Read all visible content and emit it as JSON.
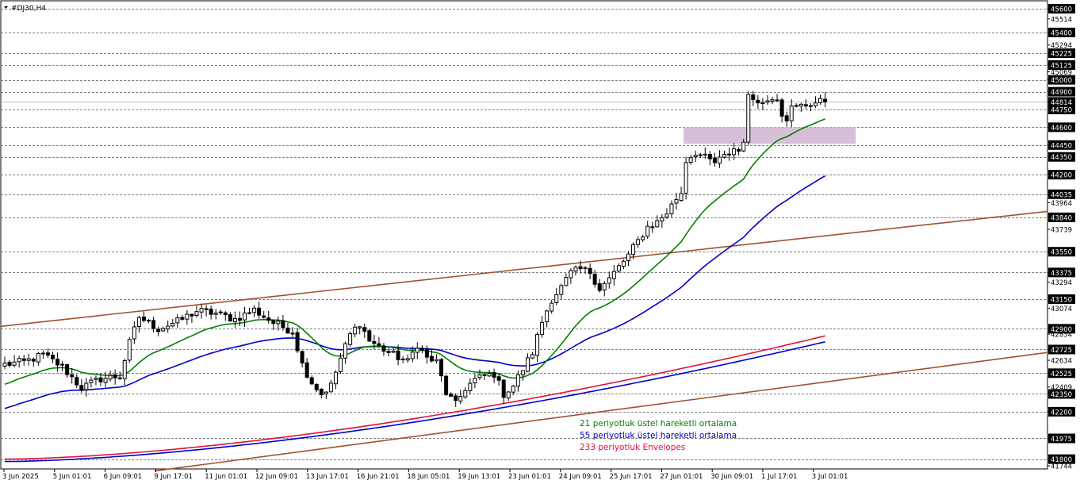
{
  "window": {
    "symbol_title": "#DJ30,H4"
  },
  "chart_data": {
    "type": "candlestick",
    "symbol": "#DJ30",
    "timeframe": "H4",
    "ylim": [
      41744,
      45600
    ],
    "current_price": 44814,
    "price_axis_labels": [
      45600,
      45514,
      45400,
      45294,
      45225,
      45125,
      45069,
      45000,
      44900,
      44814,
      44750,
      44600,
      44450,
      44350,
      44200,
      44035,
      43964,
      43840,
      43739,
      43550,
      43375,
      43294,
      43150,
      43074,
      42900,
      42854,
      42725,
      42634,
      42525,
      42409,
      42350,
      42200,
      41975,
      41800,
      41744
    ],
    "horizontal_levels": [
      45600,
      45400,
      45225,
      45125,
      45000,
      44900,
      44750,
      44600,
      44450,
      44350,
      44200,
      44035,
      43840,
      43550,
      43375,
      43150,
      42900,
      42725,
      42525,
      42350,
      42200,
      41975,
      41800
    ],
    "time_labels": [
      "3 Jun 2025",
      "5 Jun 01:01",
      "6 Jun 09:01",
      "9 Jun 17:01",
      "11 Jun 01:01",
      "12 Jun 09:01",
      "13 Jun 17:01",
      "16 Jun 21:01",
      "18 Jun 05:01",
      "19 Jun 13:01",
      "23 Jun 01:01",
      "24 Jun 09:01",
      "25 Jun 17:01",
      "27 Jun 01:01",
      "30 Jun 09:01",
      "1 Jul 17:01",
      "3 Jul 01:01"
    ],
    "candles_count": 172,
    "waypoints": [
      [
        0,
        42600
      ],
      [
        4,
        42620
      ],
      [
        8,
        42680
      ],
      [
        12,
        42580
      ],
      [
        16,
        42400
      ],
      [
        20,
        42480
      ],
      [
        24,
        42500
      ],
      [
        26,
        42780
      ],
      [
        28,
        43000
      ],
      [
        32,
        42900
      ],
      [
        36,
        42960
      ],
      [
        40,
        43050
      ],
      [
        44,
        43030
      ],
      [
        48,
        42980
      ],
      [
        52,
        43060
      ],
      [
        56,
        42950
      ],
      [
        60,
        42880
      ],
      [
        62,
        42600
      ],
      [
        64,
        42450
      ],
      [
        66,
        42350
      ],
      [
        68,
        42420
      ],
      [
        70,
        42650
      ],
      [
        72,
        42850
      ],
      [
        74,
        42950
      ],
      [
        76,
        42800
      ],
      [
        80,
        42700
      ],
      [
        84,
        42620
      ],
      [
        86,
        42770
      ],
      [
        88,
        42650
      ],
      [
        90,
        42620
      ],
      [
        92,
        42360
      ],
      [
        94,
        42260
      ],
      [
        96,
        42400
      ],
      [
        98,
        42470
      ],
      [
        100,
        42500
      ],
      [
        102,
        42520
      ],
      [
        104,
        42350
      ],
      [
        106,
        42420
      ],
      [
        108,
        42560
      ],
      [
        110,
        42700
      ],
      [
        112,
        42960
      ],
      [
        114,
        43150
      ],
      [
        116,
        43250
      ],
      [
        118,
        43370
      ],
      [
        120,
        43400
      ],
      [
        122,
        43380
      ],
      [
        124,
        43240
      ],
      [
        126,
        43320
      ],
      [
        128,
        43420
      ],
      [
        130,
        43520
      ],
      [
        132,
        43640
      ],
      [
        134,
        43760
      ],
      [
        136,
        43800
      ],
      [
        138,
        43880
      ],
      [
        140,
        44000
      ],
      [
        141,
        44050
      ],
      [
        142,
        44320
      ],
      [
        144,
        44390
      ],
      [
        146,
        44340
      ],
      [
        148,
        44300
      ],
      [
        150,
        44350
      ],
      [
        152,
        44420
      ],
      [
        153,
        44400
      ],
      [
        154,
        44500
      ],
      [
        155,
        44850
      ],
      [
        157,
        44840
      ],
      [
        158,
        44800
      ],
      [
        160,
        44860
      ],
      [
        161,
        44850
      ],
      [
        162,
        44720
      ],
      [
        163,
        44680
      ],
      [
        164,
        44760
      ],
      [
        166,
        44780
      ],
      [
        168,
        44800
      ],
      [
        170,
        44814
      ],
      [
        171,
        44814
      ]
    ],
    "supply_demand_zone": {
      "low": 44460,
      "high": 44600
    },
    "indicators": [
      {
        "name": "21 periyotluk üstel hareketli ortalama",
        "color": "#008000"
      },
      {
        "name": "55 periyotluk üstel hareketli ortalama",
        "color": "#0000cd"
      },
      {
        "name": "233 periyotluk Envelopes",
        "color": "#dc143c"
      }
    ],
    "envelope_lines": {
      "upper_start": 41800,
      "upper_end": 42840,
      "lower_start": 41780,
      "lower_end": 42790
    },
    "trend_channel": {
      "color": "#a0522d",
      "upper": {
        "start_price": 42920,
        "end_price": 43890
      },
      "lower": {
        "start_price": 41700,
        "end_price": 42700
      }
    },
    "colors": {
      "background": "#ffffff",
      "grid": "#808080",
      "bull_candle_fill": "#ffffff",
      "bear_candle_fill": "#000000",
      "candle_outline": "#000000",
      "current_price_line": "#c0c0c0",
      "zone_fill": "#d8bfd8"
    }
  }
}
